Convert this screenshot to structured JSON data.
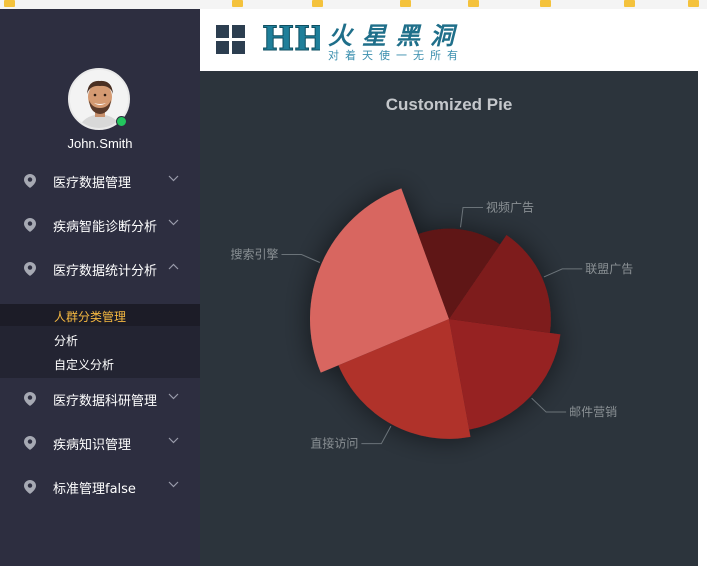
{
  "sidebar": {
    "username": "John.Smith",
    "menu": [
      {
        "label": "医疗数据管理",
        "icon": "location-pin-icon",
        "expanded": false
      },
      {
        "label": "疾病智能诊断分析",
        "icon": "location-pin-icon",
        "expanded": false
      },
      {
        "label": "医疗数据统计分析",
        "icon": "location-pin-icon",
        "expanded": true
      },
      {
        "label": "医疗数据科研管理",
        "icon": "location-pin-icon",
        "expanded": false
      },
      {
        "label": "疾病知识管理",
        "icon": "location-pin-icon",
        "expanded": false
      },
      {
        "label": "标准管理false",
        "icon": "location-pin-icon",
        "expanded": false
      }
    ],
    "submenu": [
      {
        "label": "人群分类管理",
        "active": true
      },
      {
        "label": "分析",
        "active": false
      },
      {
        "label": "自定义分析",
        "active": false
      }
    ]
  },
  "header": {
    "logo_letters": "HH",
    "logo_title": "火星黑洞",
    "logo_subtitle": "对着天使一无所有"
  },
  "colors": {
    "sidebar_bg": "#2d2e40",
    "chart_bg": "#2c343c",
    "active_menu": "#f5b841",
    "online_dot": "#23c65e",
    "logo_blue": "#1f6f8a"
  },
  "chart_data": {
    "type": "pie",
    "title": "Customized Pie",
    "subtype": "rose (radius by value)",
    "series": [
      {
        "name": "视频广告",
        "value": 235,
        "color": "#5e1414"
      },
      {
        "name": "联盟广告",
        "value": 274,
        "color": "#7e1b1b"
      },
      {
        "name": "邮件营销",
        "value": 310,
        "color": "#962020"
      },
      {
        "name": "直接访问",
        "value": 335,
        "color": "#b0302c"
      },
      {
        "name": "搜索引擎",
        "value": 400,
        "color": "#d86660"
      }
    ]
  }
}
